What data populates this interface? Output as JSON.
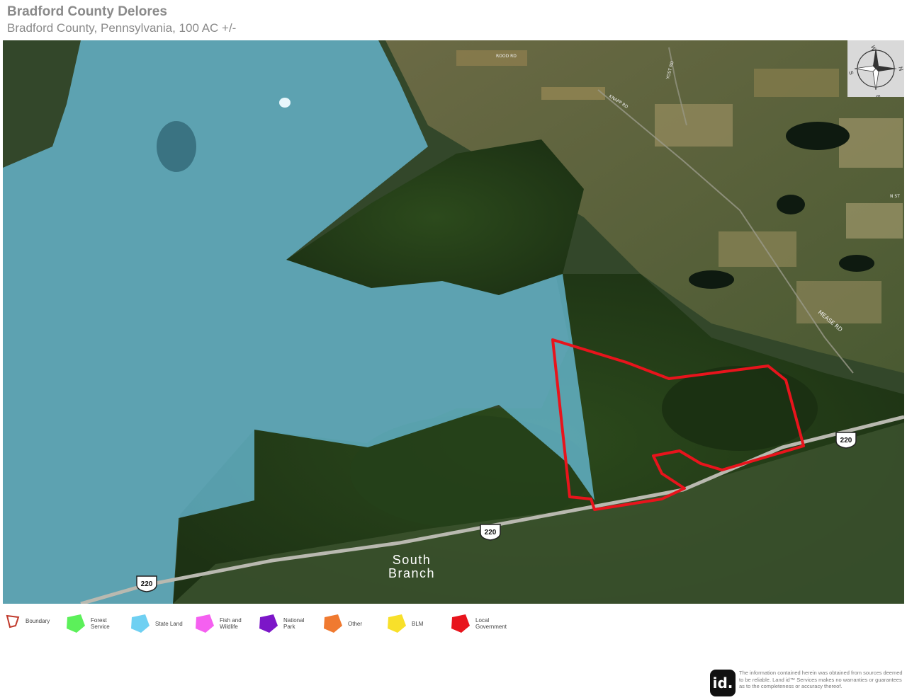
{
  "header": {
    "title": "Bradford County Delores",
    "subtitle": "Bradford County, Pennsylvania, 100 AC +/-"
  },
  "map": {
    "place_label": [
      "South",
      "Branch"
    ],
    "road_labels": [
      "ROOD RD",
      "MEASE RD",
      "KNAPP RD",
      "YOST RD",
      "N ST"
    ],
    "highway_shields": [
      "220",
      "220",
      "220"
    ],
    "compass_letters": [
      "W",
      "N",
      "E",
      "S"
    ],
    "colors": {
      "boundary": "#e8141c",
      "state_land": "#6ec6e6",
      "forest": "#2f4a22"
    }
  },
  "legend": [
    {
      "label": "Boundary",
      "color": "#c0392b",
      "outline": true,
      "icon": "boundary-icon"
    },
    {
      "label": "Forest Service",
      "color": "#5cf05a",
      "icon": "forest-service-swatch"
    },
    {
      "label": "State Land",
      "color": "#6fd0f2",
      "icon": "state-land-swatch"
    },
    {
      "label": "Fish and Wildlife",
      "color": "#f560f0",
      "icon": "fish-wildlife-swatch"
    },
    {
      "label": "National Park",
      "color": "#7c16c8",
      "icon": "national-park-swatch"
    },
    {
      "label": "Other",
      "color": "#f07a30",
      "icon": "other-swatch"
    },
    {
      "label": "BLM",
      "color": "#f8e02a",
      "icon": "blm-swatch"
    },
    {
      "label": "Local Government",
      "color": "#e8141c",
      "icon": "local-government-swatch"
    }
  ],
  "footer": {
    "logo_text": "id.",
    "disclaimer": "The information contained herein was obtained from sources deemed to be reliable. Land id™ Services makes no warranties or guarantees as to the completeness or accuracy thereof."
  }
}
